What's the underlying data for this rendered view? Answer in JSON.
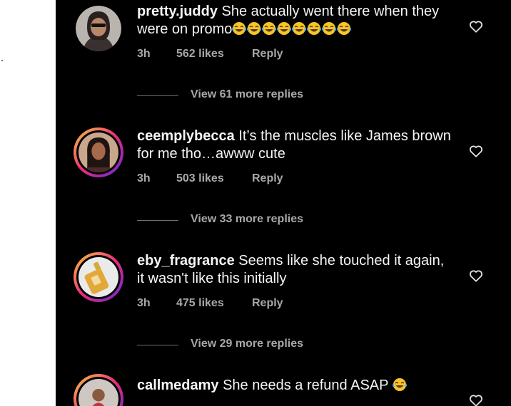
{
  "comments": [
    {
      "username": "pretty.juddy",
      "text": " She actually went there when they were on promo",
      "emoji_count": 8,
      "time": "3h",
      "likes": "562 likes",
      "reply": "Reply",
      "view_replies": "View 61 more replies",
      "avatar_ring": false
    },
    {
      "username": "ceemplybecca",
      "text": " It’s the muscles like James brown for me tho…awww cute",
      "emoji_count": 0,
      "time": "3h",
      "likes": "503 likes",
      "reply": "Reply",
      "view_replies": "View 33 more replies",
      "avatar_ring": true
    },
    {
      "username": "eby_fragrance",
      "text": " Seems like she touched it again, it wasn't like this initially",
      "emoji_count": 0,
      "time": "3h",
      "likes": "475 likes",
      "reply": "Reply",
      "view_replies": "View 29 more replies",
      "avatar_ring": true
    },
    {
      "username": "callmedamy",
      "text": " She needs a refund ASAP ",
      "emoji_count": 1,
      "avatar_ring": true
    }
  ],
  "colors": {
    "background": "#000000",
    "text": "#f5f5f5",
    "secondary": "#a8a8a8",
    "story_ring": "#ee2a7b"
  },
  "icons": {
    "like": "heart-outline-icon",
    "emoji": "face-with-tears-of-joy"
  }
}
